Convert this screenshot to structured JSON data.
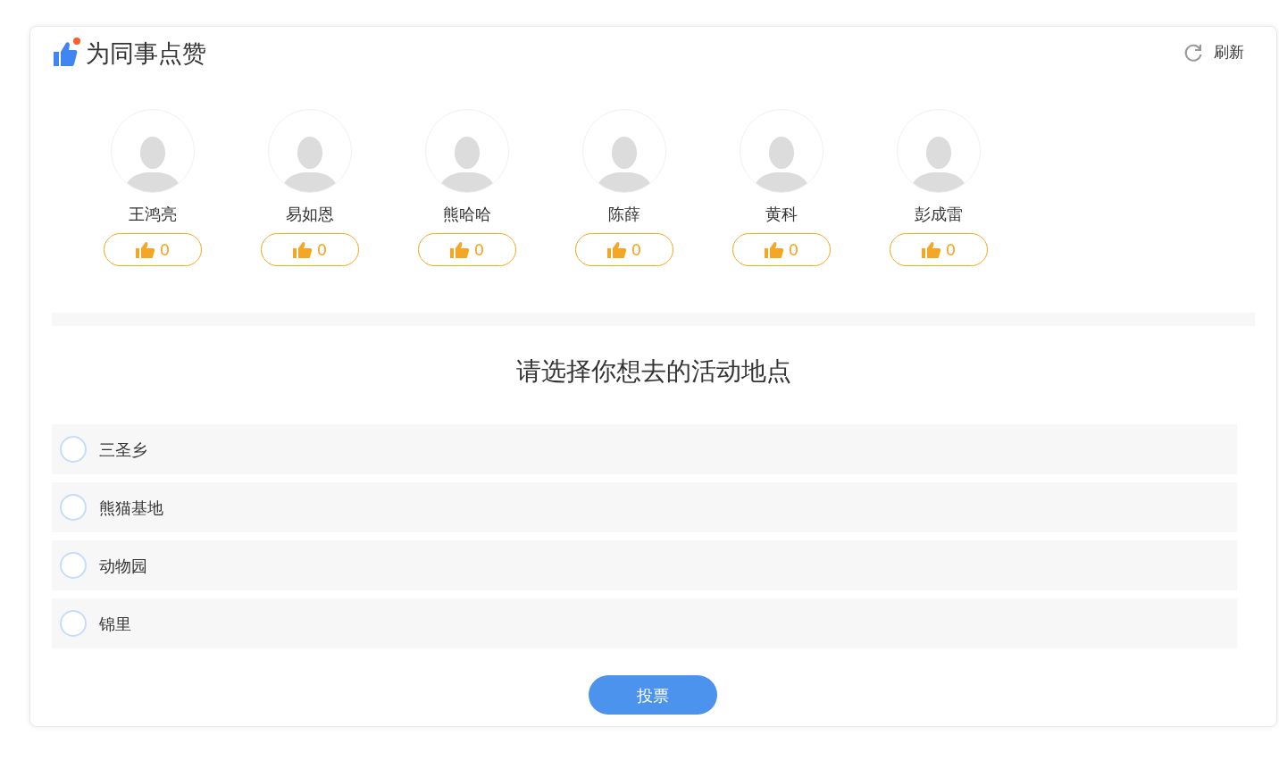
{
  "header": {
    "title": "为同事点赞",
    "refresh": "刷新"
  },
  "colleagues": [
    {
      "name": "王鸿亮",
      "likes": "0"
    },
    {
      "name": "易如恩",
      "likes": "0"
    },
    {
      "name": "熊哈哈",
      "likes": "0"
    },
    {
      "name": "陈薛",
      "likes": "0"
    },
    {
      "name": "黄科",
      "likes": "0"
    },
    {
      "name": "彭成雷",
      "likes": "0"
    }
  ],
  "poll": {
    "question": "请选择你想去的活动地点",
    "options": [
      {
        "label": "三圣乡",
        "selected": false
      },
      {
        "label": "熊猫基地",
        "selected": false
      },
      {
        "label": "动物园",
        "selected": false
      },
      {
        "label": "锦里",
        "selected": false
      }
    ],
    "submit": "投票"
  }
}
